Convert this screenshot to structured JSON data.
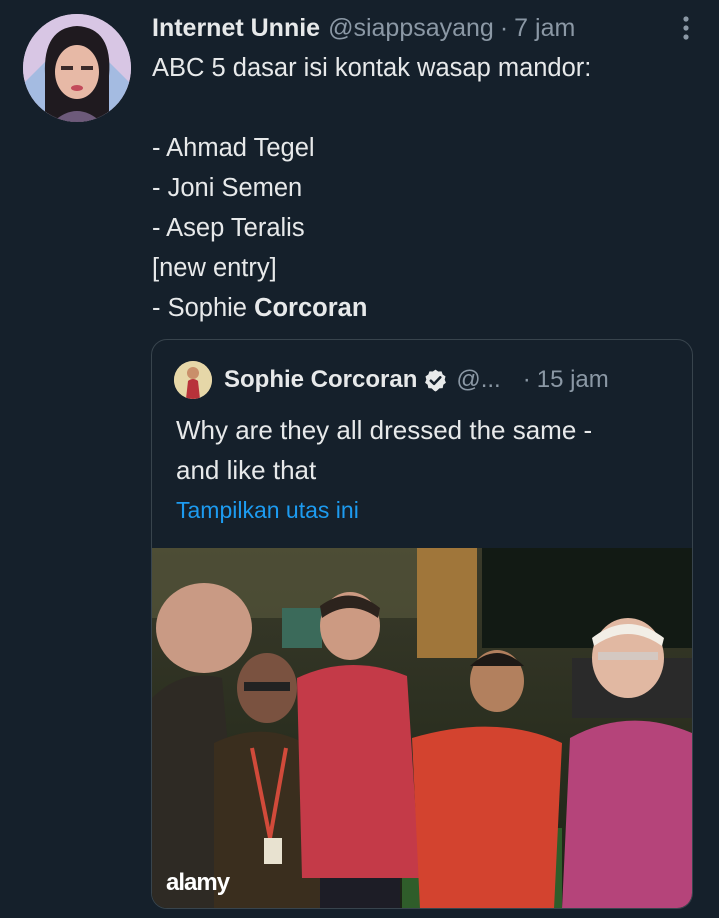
{
  "tweet": {
    "author_name": "Internet Unnie",
    "author_handle": "@siappsayang",
    "separator": "·",
    "time": "7 jam",
    "lines": [
      "ABC 5 dasar isi kontak wasap mandor:",
      "",
      "- Ahmad Tegel",
      "- Joni Semen",
      "- Asep Teralis",
      "[new entry]",
      "- Sophie "
    ],
    "last_line_bold": "Corcoran"
  },
  "quoted_tweet": {
    "author_name": "Sophie Corcoran",
    "author_handle": "@...",
    "separator": "·",
    "time": "15 jam",
    "text_lines": [
      "Why are they all dressed the same -",
      "and like that"
    ],
    "show_thread_link": "Tampilkan utas ini",
    "image_watermark": "alamy"
  },
  "icons": {
    "more": "more-vertical-icon",
    "verified": "verified-badge-icon"
  },
  "colors": {
    "background": "#15202b",
    "text": "#e7e9ea",
    "secondary": "#8b98a5",
    "link": "#1d9bf0",
    "border": "#38444d"
  }
}
